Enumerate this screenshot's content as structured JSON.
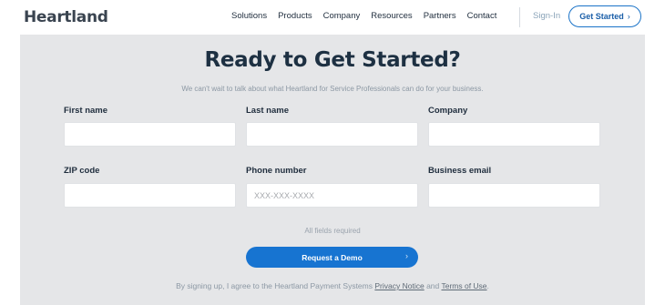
{
  "header": {
    "logo": "Heartland",
    "nav": [
      "Solutions",
      "Products",
      "Company",
      "Resources",
      "Partners",
      "Contact"
    ],
    "signin": "Sign-In",
    "get_started": "Get Started",
    "get_started_chevron": "›"
  },
  "form": {
    "title": "Ready to Get Started?",
    "subtitle": "We can't wait to talk about what Heartland for Service Professionals can do for your business.",
    "fields": [
      {
        "label": "First name",
        "value": "",
        "placeholder": ""
      },
      {
        "label": "Last name",
        "value": "",
        "placeholder": ""
      },
      {
        "label": "Company",
        "value": "",
        "placeholder": ""
      },
      {
        "label": "ZIP code",
        "value": "",
        "placeholder": ""
      },
      {
        "label": "Phone number",
        "value": "",
        "placeholder": "XXX-XXX-XXXX"
      },
      {
        "label": "Business email",
        "value": "",
        "placeholder": ""
      }
    ],
    "required_note": "All fields required",
    "submit_label": "Request a Demo",
    "submit_chevron": "›",
    "consent_prefix": "By signing up, I agree to the Heartland Payment Systems",
    "privacy_link": "Privacy Notice",
    "consent_and": "and",
    "terms_link": "Terms of Use",
    "consent_suffix": "."
  },
  "colors": {
    "accent": "#1774d1",
    "section_bg": "#e5e6e8",
    "title": "#1d3042"
  },
  "icons": {
    "get_started_arrow": "chevron-right-icon",
    "submit_arrow": "chevron-right-icon"
  }
}
